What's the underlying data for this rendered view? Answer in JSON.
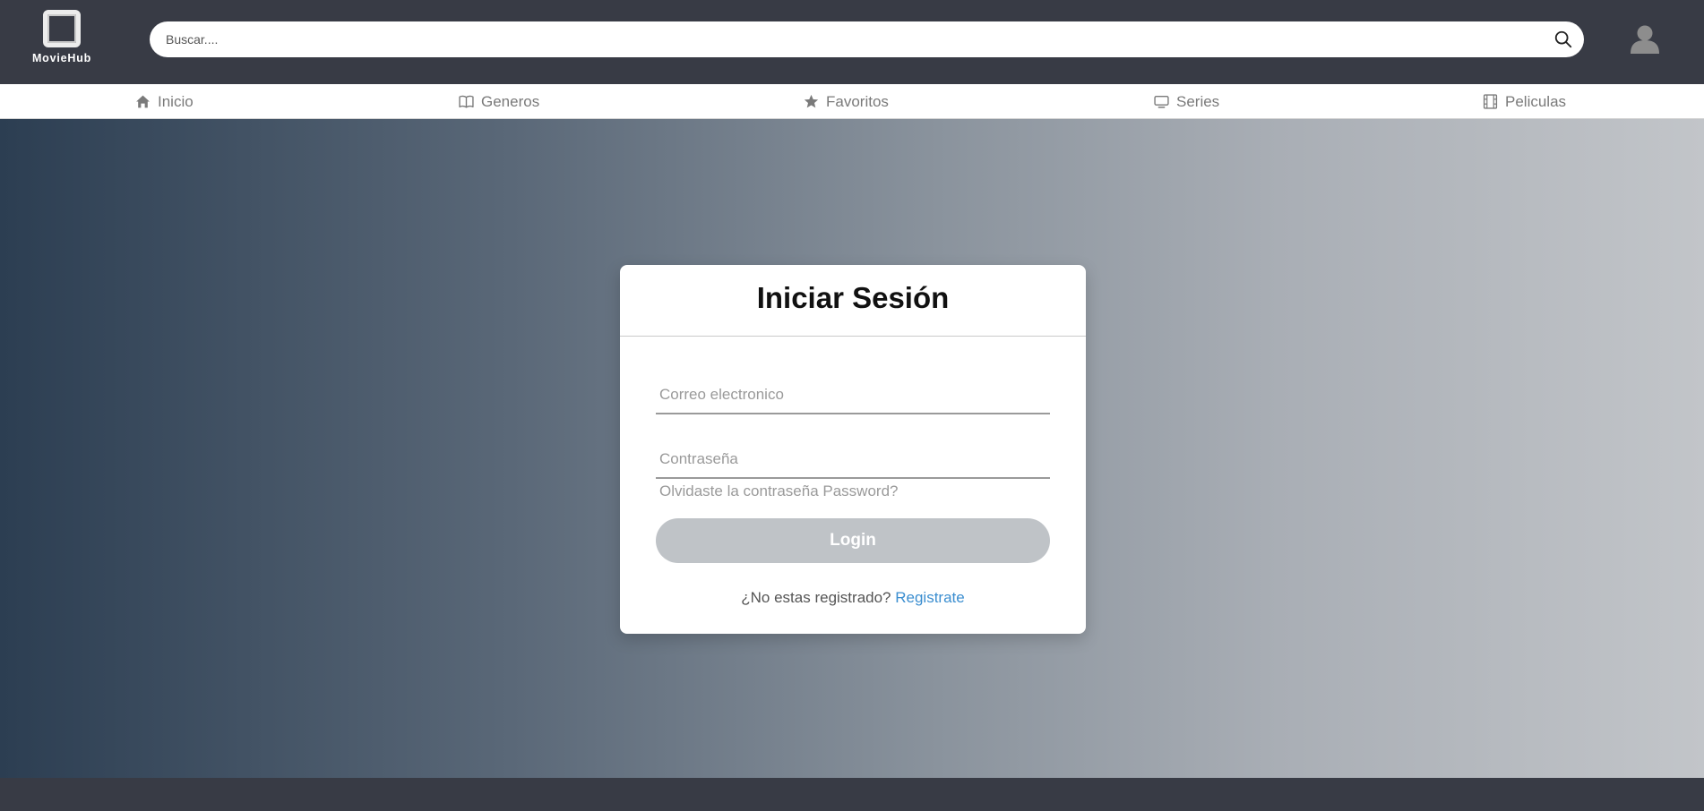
{
  "app": {
    "logo_text": "MovieHub"
  },
  "search": {
    "placeholder": "Buscar....",
    "value": ""
  },
  "nav": {
    "items": [
      {
        "label": "Inicio",
        "icon": "home-icon"
      },
      {
        "label": "Generos",
        "icon": "book-icon"
      },
      {
        "label": "Favoritos",
        "icon": "star-icon"
      },
      {
        "label": "Series",
        "icon": "tv-icon"
      },
      {
        "label": "Peliculas",
        "icon": "film-icon"
      }
    ]
  },
  "login": {
    "title": "Iniciar Sesión",
    "email_placeholder": "Correo electronico",
    "password_placeholder": "Contraseña",
    "forgot_label": "Olvidaste la contraseña Password?",
    "submit_label": "Login",
    "register_prompt": "¿No estas registrado?",
    "register_link": "Registrate"
  },
  "colors": {
    "topbar": "#383b45",
    "accent_link": "#3b8ed0",
    "button_disabled": "#bfc3c7"
  }
}
